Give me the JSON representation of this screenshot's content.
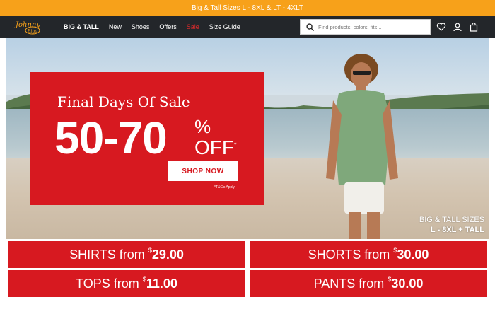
{
  "topbar": {
    "text": "Big & Tall Sizes L - 8XL & LT - 4XLT"
  },
  "nav": {
    "logo_alt": "Johnny Bigg",
    "links": [
      "BIG & TALL",
      "New",
      "Shoes",
      "Offers",
      "Sale",
      "Size Guide"
    ],
    "search_placeholder": "Find products, colors, fits...",
    "icons": [
      "heart-icon",
      "user-icon",
      "bag-icon"
    ]
  },
  "hero": {
    "promo": {
      "title": "Final Days Of Sale",
      "range": "50-70",
      "percent": "%",
      "off": "OFF",
      "asterisk": "*",
      "cta": "SHOP NOW",
      "tc": "*T&C's Apply"
    },
    "caption_line1": "BIG & TALL SIZES",
    "caption_line2": "L - 8XL + TALL"
  },
  "tiles": [
    {
      "label": "SHIRTS from ",
      "currency": "$",
      "price": "29.00"
    },
    {
      "label": "SHORTS from ",
      "currency": "$",
      "price": "30.00"
    },
    {
      "label": "TOPS from ",
      "currency": "$",
      "price": "11.00"
    },
    {
      "label": "PANTS from ",
      "currency": "$",
      "price": "30.00"
    }
  ],
  "colors": {
    "accent_red": "#d71920",
    "topbar_orange": "#f7a11a",
    "nav_bg": "#23262a",
    "sale_link": "#e02b2b"
  }
}
